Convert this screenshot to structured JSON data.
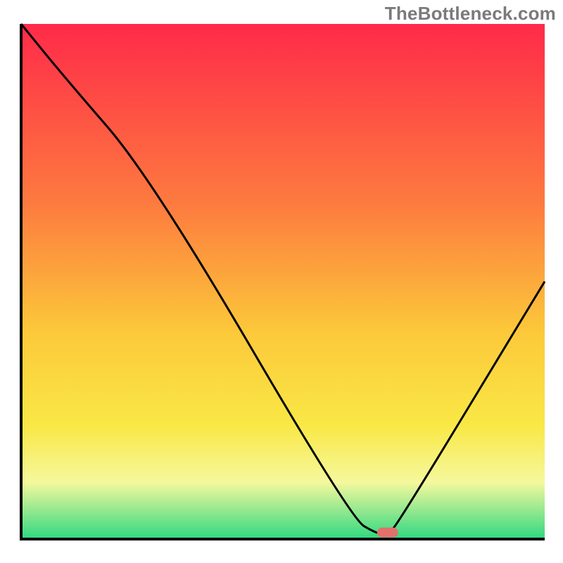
{
  "watermark": "TheBottleneck.com",
  "chart_data": {
    "type": "line",
    "title": "",
    "xlabel": "",
    "ylabel": "",
    "xlim": [
      0,
      100
    ],
    "ylim": [
      0,
      100
    ],
    "x": [
      0,
      8,
      25,
      63,
      68,
      70,
      72,
      100
    ],
    "values": [
      100,
      90,
      70,
      4,
      1,
      1,
      3,
      50
    ],
    "marker": {
      "x": 70,
      "y": 1
    },
    "colors": {
      "gradient_top": "#ff2a49",
      "gradient_mid1": "#fd7b3f",
      "gradient_mid2": "#fcc93a",
      "gradient_mid3": "#f9e846",
      "gradient_mid4": "#f5f89d",
      "gradient_bottom": "#2fd881",
      "marker": "#e2706d",
      "curve": "#000000",
      "axis": "#000000"
    }
  }
}
